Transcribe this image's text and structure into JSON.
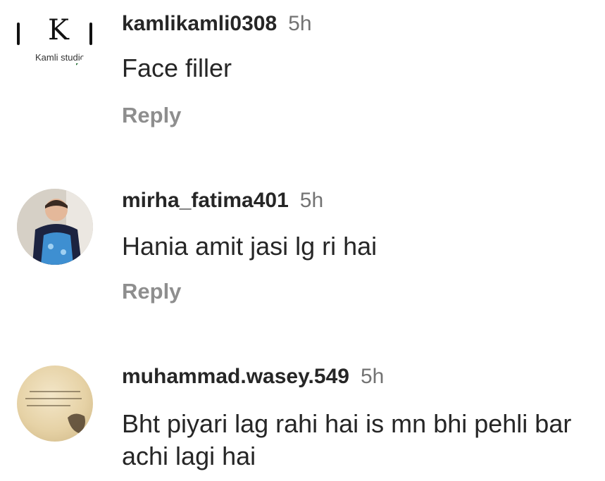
{
  "comments": [
    {
      "username": "kamlikamli0308",
      "time": "5h",
      "text": "Face filler",
      "reply_label": "Reply",
      "avatar_text": "Kamli studio",
      "avatar_mark": "K"
    },
    {
      "username": "mirha_fatima401",
      "time": "5h",
      "text": "Hania amit jasi lg ri hai",
      "reply_label": "Reply"
    },
    {
      "username": "muhammad.wasey.549",
      "time": "5h",
      "text": "Bht piyari lag rahi hai is mn bhi pehli bar achi lagi hai"
    }
  ],
  "colors": {
    "username": "#262626",
    "time": "#737373",
    "reply": "#8e8e8e",
    "background": "#ffffff"
  }
}
